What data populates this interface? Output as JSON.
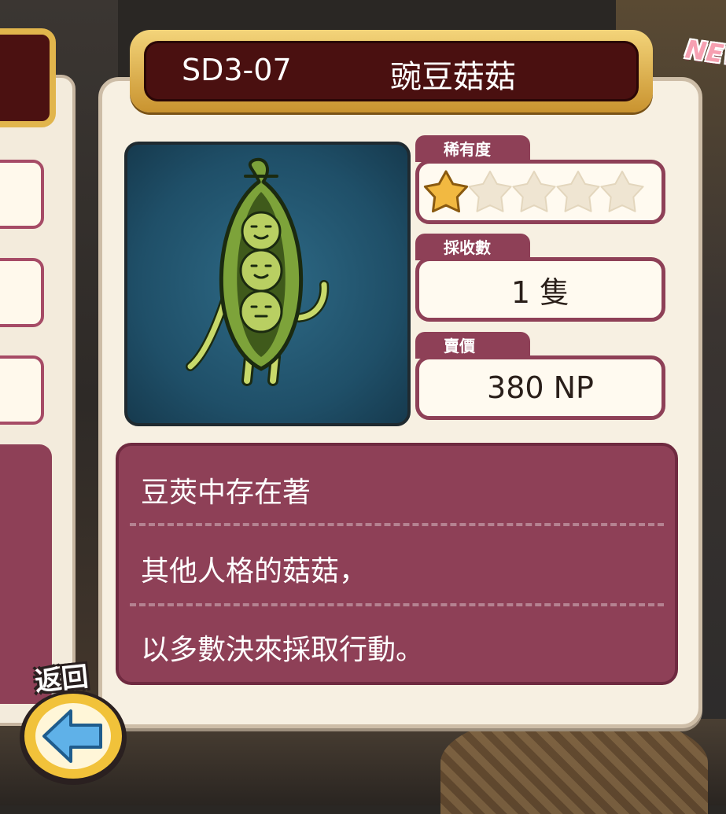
{
  "card": {
    "id": "SD3-07",
    "name": "豌豆菇菇",
    "badge": "NEW!"
  },
  "stats": {
    "rarity": {
      "label": "稀有度",
      "value": 1,
      "max": 5
    },
    "harvest": {
      "label": "採收數",
      "value": "1 隻"
    },
    "price": {
      "label": "賣價",
      "value": "380 NP"
    }
  },
  "description": {
    "lines": [
      "豆莢中存在著",
      "其他人格的菇菇，",
      "以多數決來採取行動。"
    ]
  },
  "back_button": {
    "label": "返回"
  },
  "colors": {
    "panel": "#8e4057",
    "title_bg": "#4a1010",
    "gold": "#e1b54c",
    "star_on": "#f2b941",
    "star_off": "#efe5d2"
  }
}
